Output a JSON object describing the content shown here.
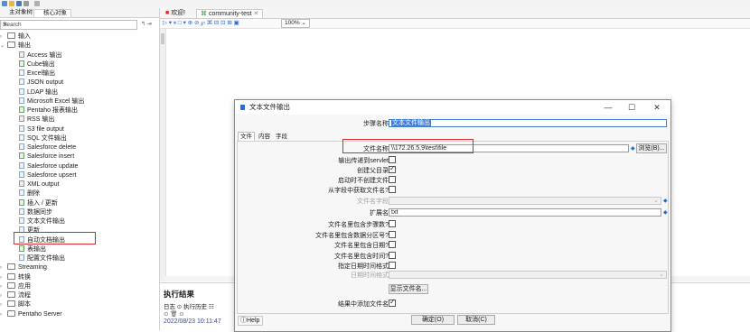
{
  "left_panel": {
    "tabs": [
      "主对象树",
      "核心对象"
    ],
    "search_placeholder": "Search",
    "search_clear": "✕",
    "search_options": "↰ ⇥",
    "tree": [
      {
        "label": "输入",
        "level": 0,
        "expanded": false
      },
      {
        "label": "输出",
        "level": 0,
        "expanded": true
      },
      {
        "label": "Access 输出",
        "level": 1
      },
      {
        "label": "Cube输出",
        "level": 1
      },
      {
        "label": "Excel输出",
        "level": 1
      },
      {
        "label": "JSON output",
        "level": 1
      },
      {
        "label": "LDAP 输出",
        "level": 1
      },
      {
        "label": "Microsoft Excel 输出",
        "level": 1
      },
      {
        "label": "Pentaho 报表输出",
        "level": 1
      },
      {
        "label": "RSS 输出",
        "level": 1
      },
      {
        "label": "S3 file output",
        "level": 1
      },
      {
        "label": "SQL 文件输出",
        "level": 1
      },
      {
        "label": "Salesforce delete",
        "level": 1
      },
      {
        "label": "Salesforce insert",
        "level": 1
      },
      {
        "label": "Salesforce update",
        "level": 1
      },
      {
        "label": "Salesforce upsert",
        "level": 1
      },
      {
        "label": "XML output",
        "level": 1
      },
      {
        "label": "删除",
        "level": 1
      },
      {
        "label": "插入 / 更新",
        "level": 1
      },
      {
        "label": "数据同步",
        "level": 1
      },
      {
        "label": "文本文件输出",
        "level": 1,
        "selected": true
      },
      {
        "label": "更新",
        "level": 1
      },
      {
        "label": "自动文档输出",
        "level": 1
      },
      {
        "label": "表输出",
        "level": 1
      },
      {
        "label": "配置文件输出",
        "level": 1
      },
      {
        "label": "Streaming",
        "level": 0,
        "expanded": false
      },
      {
        "label": "转换",
        "level": 0,
        "expanded": false
      },
      {
        "label": "应用",
        "level": 0,
        "expanded": false
      },
      {
        "label": "流程",
        "level": 0,
        "expanded": false
      },
      {
        "label": "脚本",
        "level": 0,
        "expanded": false
      },
      {
        "label": "Pentaho Server",
        "level": 0,
        "expanded": false
      }
    ]
  },
  "editor": {
    "tabs": [
      "欢迎!",
      "community-test"
    ],
    "tab_close": "✕",
    "zoom": "100% ⌄",
    "tool_icons": "▷ ▾ ⏸ □ ▾ ⊕ ⊘ ℘ ⌘ ⊟ ⊡ ⊞ ▣"
  },
  "exec": {
    "title": "执行结果",
    "tabs": "日志  ⊙ 执行历史 ☷",
    "tools": "⊙ 🗑 ⊙",
    "timestamp": "2022/08/23 10:11:47"
  },
  "dialog": {
    "title": "文本文件输出",
    "win_min": "—",
    "win_max": "☐",
    "win_close": "✕",
    "step_name_label": "步骤名称",
    "step_name_value": "文本文件输出",
    "tabs": [
      "文件",
      "内容",
      "字段"
    ],
    "filename_label": "文件名称",
    "filename_value": "\\\\172.26.5.9\\test\\file",
    "browse_button": "浏览(B)...",
    "checkbox_rows": [
      {
        "label": "输出传递到servlet",
        "checked": false
      },
      {
        "label": "创建父目录",
        "checked": true
      },
      {
        "label": "启动时不创建文件",
        "checked": false
      },
      {
        "label": "从字段中获取文件名?",
        "checked": false
      }
    ],
    "filename_field_label": "文件名字段",
    "extension_label": "扩展名",
    "extension_value": "txt",
    "checkbox_rows_2": [
      {
        "label": "文件名里包含步骤数?",
        "checked": false
      },
      {
        "label": "文件名里包含数据分区号?",
        "checked": false
      },
      {
        "label": "文件名里包含日期?",
        "checked": false
      },
      {
        "label": "文件名里包含时间?",
        "checked": false
      },
      {
        "label": "指定日期时间格式",
        "checked": false
      }
    ],
    "datetime_format_label": "日期时间格式",
    "show_filename_button": "显示文件名...",
    "add_filenames_label": "结果中添加文件名",
    "add_filenames_checked": true,
    "help_button": "Help",
    "ok_button": "确定(O)",
    "cancel_button": "取消(C)"
  }
}
